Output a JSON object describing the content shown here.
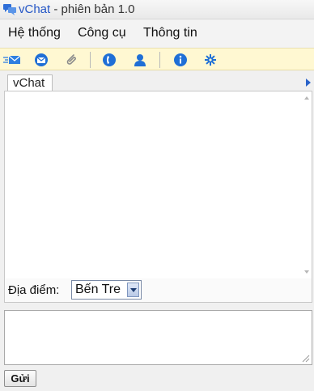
{
  "window": {
    "brand": "vChat",
    "title_rest": " - phiên bản 1.0"
  },
  "menu": {
    "items": [
      {
        "label": "Hệ thống"
      },
      {
        "label": "Công cụ"
      },
      {
        "label": "Thông tin"
      }
    ]
  },
  "toolbar": {
    "icons": [
      "send-message-icon",
      "email-icon",
      "attachment-icon",
      "call-icon",
      "contact-icon",
      "info-icon",
      "settings-icon"
    ]
  },
  "tabs": [
    {
      "label": "vChat"
    }
  ],
  "location": {
    "label": "Địa điểm:",
    "selected": "Bến Tre"
  },
  "message_input": {
    "value": "",
    "placeholder": ""
  },
  "send_button": {
    "label": "Gửi"
  },
  "colors": {
    "brand": "#2456c6",
    "toolbar_bg": "#fff8d2",
    "icon_blue": "#1f6fd6"
  }
}
